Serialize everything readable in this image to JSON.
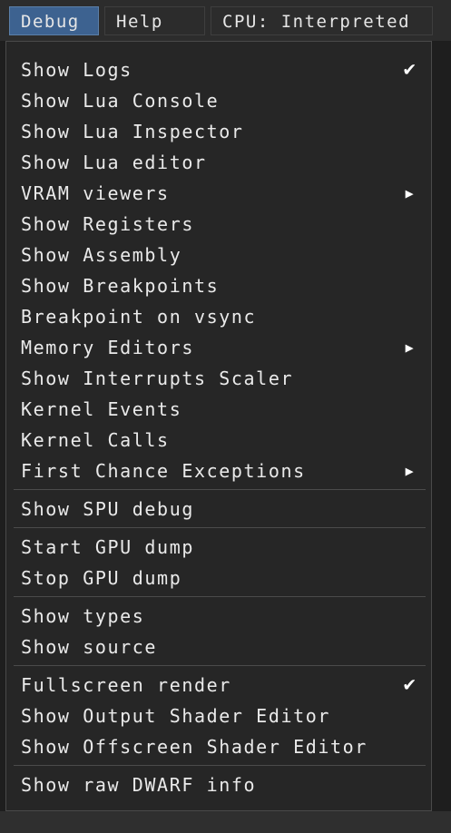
{
  "menubar": {
    "debug": "Debug",
    "help": "Help",
    "cpu": "CPU: Interpreted"
  },
  "menu": {
    "groups": [
      [
        {
          "label": "Show Logs",
          "mark": "check"
        },
        {
          "label": "Show Lua Console",
          "mark": ""
        },
        {
          "label": "Show Lua Inspector",
          "mark": ""
        },
        {
          "label": "Show Lua editor",
          "mark": ""
        },
        {
          "label": "VRAM viewers",
          "mark": "submenu"
        },
        {
          "label": "Show Registers",
          "mark": ""
        },
        {
          "label": "Show Assembly",
          "mark": ""
        },
        {
          "label": "Show Breakpoints",
          "mark": ""
        },
        {
          "label": "Breakpoint on vsync",
          "mark": ""
        },
        {
          "label": "Memory Editors",
          "mark": "submenu"
        },
        {
          "label": "Show Interrupts Scaler",
          "mark": ""
        },
        {
          "label": "Kernel Events",
          "mark": ""
        },
        {
          "label": "Kernel Calls",
          "mark": ""
        },
        {
          "label": "First Chance Exceptions",
          "mark": "submenu"
        }
      ],
      [
        {
          "label": "Show SPU debug",
          "mark": ""
        }
      ],
      [
        {
          "label": "Start GPU dump",
          "mark": ""
        },
        {
          "label": "Stop GPU dump",
          "mark": ""
        }
      ],
      [
        {
          "label": "Show types",
          "mark": ""
        },
        {
          "label": "Show source",
          "mark": ""
        }
      ],
      [
        {
          "label": "Fullscreen render",
          "mark": "check"
        },
        {
          "label": "Show Output Shader Editor",
          "mark": ""
        },
        {
          "label": "Show Offscreen Shader Editor",
          "mark": ""
        }
      ],
      [
        {
          "label": "Show raw DWARF info",
          "mark": ""
        }
      ]
    ]
  }
}
